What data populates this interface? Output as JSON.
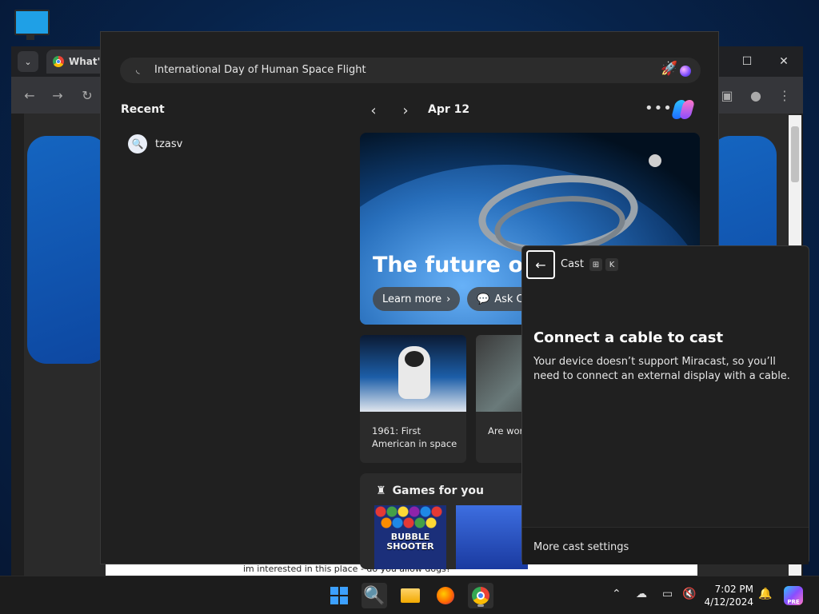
{
  "chrome": {
    "tab_title": "What's",
    "tab_dropdown_icon": "chevron-down-icon",
    "back_icon": "arrow-left-icon",
    "forward_icon": "arrow-right-icon",
    "reload_icon": "reload-icon",
    "window_controls": [
      "maximize-icon",
      "close-icon"
    ],
    "page_snippet": "im interested in this place - do you allow dogs?"
  },
  "search": {
    "query": "International Day of Human Space Flight",
    "recent_title": "Recent",
    "recent_items": [
      {
        "label": "tzasv",
        "icon": "search-icon"
      }
    ],
    "date": "Apr 12",
    "more_icon": "more-icon",
    "hero": {
      "title": "The future of s",
      "learn_more": "Learn more",
      "ask": "Ask C"
    },
    "cards": [
      {
        "text": "1961: First American in space"
      },
      {
        "text": "Are wor heading"
      }
    ],
    "games_title": "Games for you",
    "game1_logo_text": "BUBBLE SHOOTER"
  },
  "cast": {
    "title": "Cast",
    "shortcut_keys": [
      "⊞",
      "K"
    ],
    "heading": "Connect a cable to cast",
    "description": "Your device doesn’t support Miracast, so you’ll need to connect an external display with a cable.",
    "footer_link": "More cast settings"
  },
  "taskbar": {
    "time": "7:02 PM",
    "date": "4/12/2024",
    "pre_badge": "PRE"
  }
}
